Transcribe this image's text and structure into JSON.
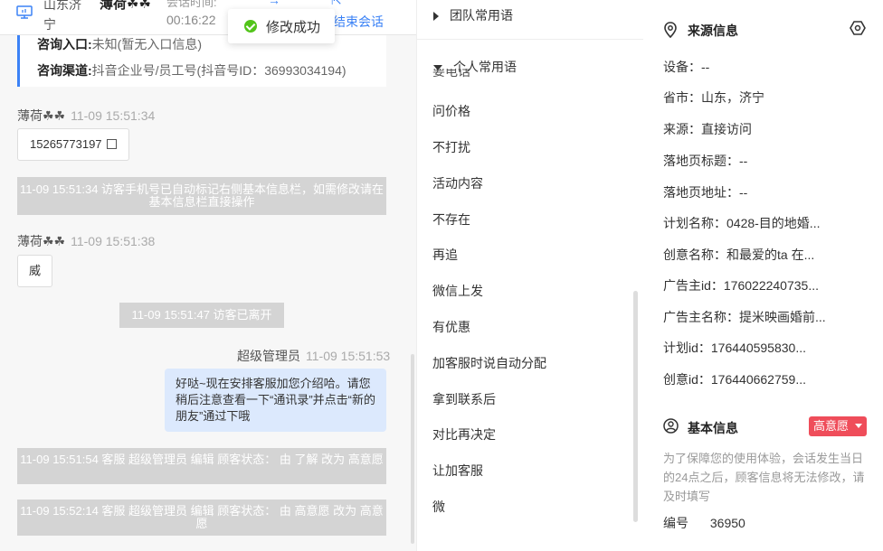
{
  "header": {
    "location": "山东济宁",
    "visitor_name": "薄荷☘☘",
    "time_label": "会话时间:",
    "time": "00:16:22",
    "end_label": "结束会话"
  },
  "toast": {
    "text": "修改成功"
  },
  "card": {
    "entry_label": "咨询入口:",
    "entry_value": "未知(暂无入口信息)",
    "channel_label": "咨询渠道:",
    "channel_value": "抖音企业号/员工号(抖音号ID：36993034194)"
  },
  "messages": {
    "m1_sender": "薄荷☘☘",
    "m1_time": "11-09 15:51:34",
    "m1_text": "15265773197",
    "sys1": "11-09 15:51:34 访客手机号已自动标记右侧基本信息栏，如需修改请在基本信息栏直接操作",
    "m2_sender": "薄荷☘☘",
    "m2_time": "11-09 15:51:38",
    "m2_text": "威",
    "sys2": "11-09 15:51:47 访客已离开",
    "agent_name": "超级管理员",
    "agent_time": "11-09 15:51:53",
    "agent_text": "好哒~现在安排客服加您介绍哈。请您稍后注意查看一下“通讯录”并点击“新的朋友”通过下哦",
    "sys3": "11-09 15:51:54 客服 超级管理员 编辑 顾客状态： 由 了解 改为 高意愿",
    "sys4": "11-09 15:52:14 客服 超级管理员 编辑 顾客状态： 由 高意愿 改为 高意愿"
  },
  "phrases": {
    "team_label": "团队常用语",
    "personal_label": "个人常用语",
    "partial_item": "要电话",
    "items": [
      "问价格",
      "不打扰",
      "活动内容",
      "不存在",
      "再追",
      "微信上发",
      "有优惠",
      "加客服时说自动分配",
      "拿到联系后",
      "对比再决定",
      "让加客服",
      "微"
    ]
  },
  "source": {
    "title": "来源信息",
    "device": "设备：--",
    "province": "省市：山东，济宁",
    "origin": "来源：直接访问",
    "landing_title": "落地页标题：--",
    "landing_url": "落地页地址：--",
    "plan_name": "计划名称：0428-目的地婚...",
    "creative_name": "创意名称：和最爱的ta 在...",
    "advertiser_id": "广告主id：176022240735...",
    "advertiser_name": "广告主名称：提米映画婚前...",
    "plan_id": "计划id：176440595830...",
    "creative_id": "创意id：176440662759..."
  },
  "basic": {
    "title": "基本信息",
    "badge": "高意愿",
    "notice": "为了保障您的使用体验，会话发生当日的24点之后，顾客信息将无法修改，请及时填写",
    "id_label": "编号",
    "id_value": "36950"
  },
  "colors": {
    "accent": "#3b82f6",
    "badge": "#ef4d5a",
    "success": "#52c41a"
  }
}
